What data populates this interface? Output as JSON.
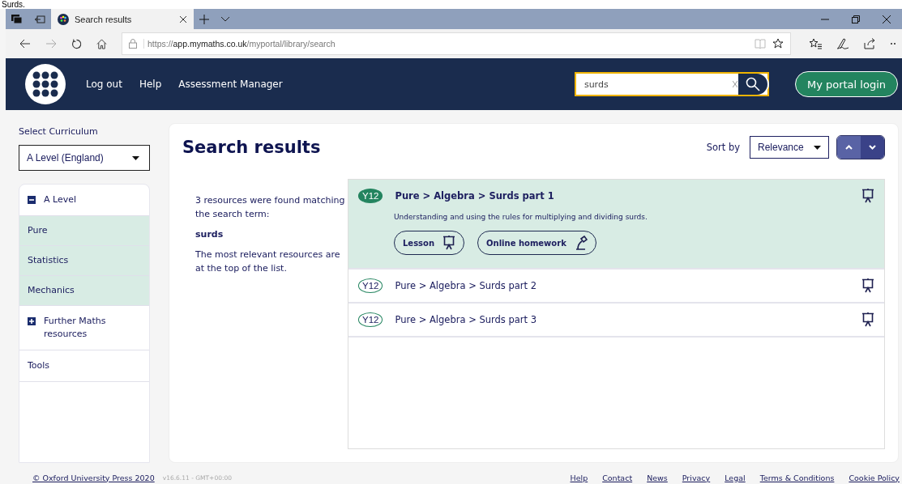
{
  "caption": "Surds.",
  "browser": {
    "tabs": [
      {
        "title": "Search results",
        "selected": true
      }
    ],
    "url_scheme": "https://",
    "url_host": "app.mymaths.co.uk",
    "url_path": "/myportal/library/search"
  },
  "header": {
    "nav": [
      "Log out",
      "Help",
      "Assessment Manager"
    ],
    "search_value": "surds",
    "login_button": "My portal login"
  },
  "sidebar": {
    "curriculum_label": "Select Curriculum",
    "curriculum_value": "A Level (England)",
    "items": [
      {
        "label": "A Level",
        "expanded": true,
        "children": [
          {
            "label": "Pure"
          },
          {
            "label": "Statistics"
          },
          {
            "label": "Mechanics"
          }
        ]
      },
      {
        "label": "Further Maths resources",
        "expanded": false
      },
      {
        "label": "Tools"
      }
    ]
  },
  "main": {
    "title": "Search results",
    "sort_label": "Sort by",
    "sort_value": "Relevance",
    "summary": "3 resources were found matching the search term:",
    "term": "surds",
    "note": "The most relevant resources are at the top of the list.",
    "results": [
      {
        "year": "Y12",
        "path": "Pure > Algebra > Surds part 1",
        "expanded": true,
        "description": "Understanding and using the rules for multiplying and dividing surds.",
        "actions": [
          {
            "label": "Lesson",
            "kind": "lesson"
          },
          {
            "label": "Online homework",
            "kind": "homework"
          }
        ]
      },
      {
        "year": "Y12",
        "path": "Pure > Algebra > Surds part 2",
        "expanded": false
      },
      {
        "year": "Y12",
        "path": "Pure > Algebra > Surds part 3",
        "expanded": false
      }
    ]
  },
  "footer": {
    "copyright": "© Oxford University Press 2020",
    "version": "v16.6.11 - GMT+00:00",
    "links": [
      "Help",
      "Contact",
      "News",
      "Privacy",
      "Legal",
      "Terms & Conditions",
      "Cookie Policy"
    ]
  }
}
